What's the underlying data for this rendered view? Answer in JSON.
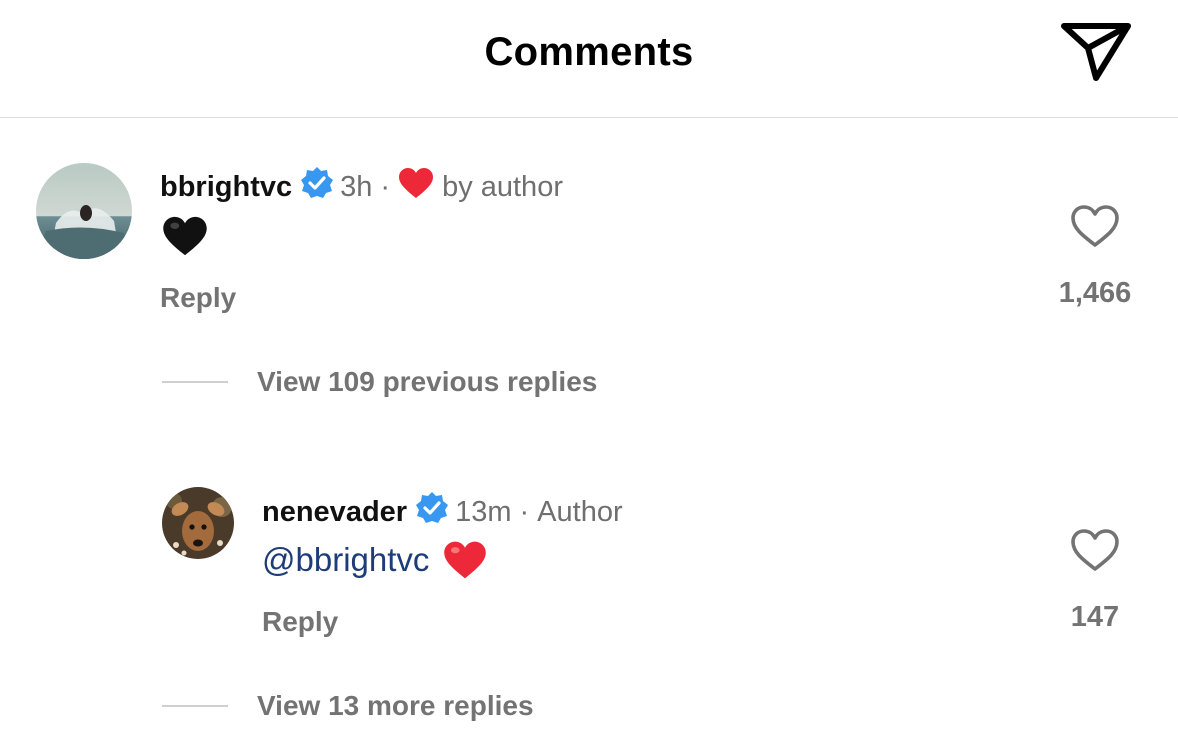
{
  "header": {
    "title": "Comments",
    "send_icon": "paper-plane-icon"
  },
  "comments": [
    {
      "username": "bbrightvc",
      "verified": true,
      "time": "3h",
      "separator": "·",
      "liked_by_author_label": "by author",
      "body_emoji": "🖤",
      "reply_label": "Reply",
      "like_count": "1,466",
      "view_replies_label": "View 109 previous replies"
    },
    {
      "username": "nenevader",
      "verified": true,
      "time": "13m",
      "separator": "·",
      "author_label": "Author",
      "mention": "@bbrightvc",
      "body_emoji": "❤️",
      "reply_label": "Reply",
      "like_count": "147",
      "view_replies_label": "View 13 more replies"
    }
  ],
  "colors": {
    "verified_badge": "#3897f0",
    "heart_red": "#ed2939",
    "mention": "#1e3d78",
    "muted": "#737373"
  }
}
